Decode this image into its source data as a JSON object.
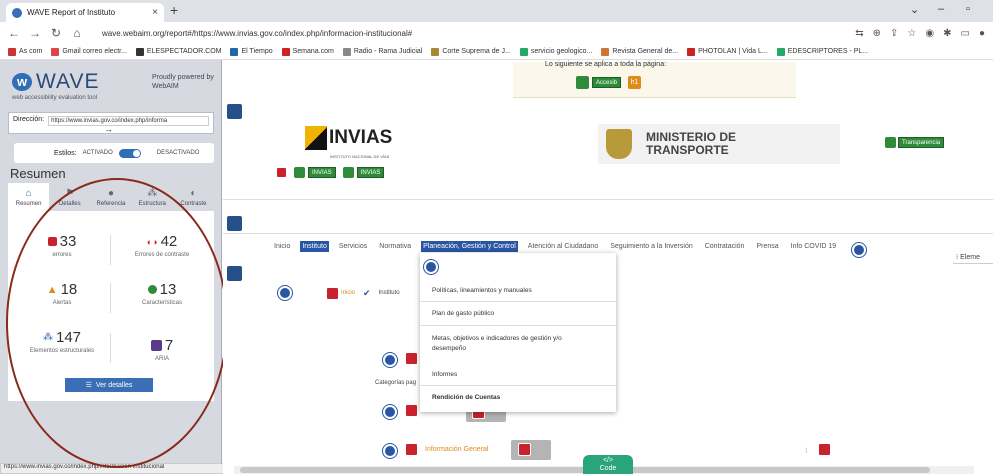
{
  "browser": {
    "tab_title": "WAVE Report of Instituto",
    "url": "wave.webaim.org/report#/https://www.invias.gov.co/index.php/informacion-institucional#",
    "bookmarks": [
      "As com",
      "Gmail correo electr...",
      "ELESPECTADOR.COM",
      "El Tiempo",
      "Semana.com",
      "Radio - Rama Judicial",
      "Corte Suprema de J...",
      "servicio geologico...",
      "Revista General de...",
      "PHOTOLAN | Vida L...",
      "EDESCRIPTORES - PL..."
    ],
    "status_url": "https://www.invias.gov.co/index.php/informacion-institucional"
  },
  "wave": {
    "logo_text": "WAVE",
    "tagline": "web accessibility evaluation tool",
    "powered_by": "Proudly powered by WebAIM",
    "address_label": "Dirección:",
    "address_value": "https://www.invias.gov.co/index.php/informa",
    "styles_label": "Estilos:",
    "styles_state": "ACTIVADO",
    "styles_off": "DESACTIVADO",
    "summary_heading": "Resumen",
    "tabs": [
      {
        "label": "Resumen",
        "icon": "home-icon"
      },
      {
        "label": "Detalles",
        "icon": "flag-icon"
      },
      {
        "label": "Referencia",
        "icon": "info-icon"
      },
      {
        "label": "Estructura",
        "icon": "structure-icon"
      },
      {
        "label": "Contraste",
        "icon": "contrast-icon"
      }
    ],
    "stats": {
      "errors": {
        "count": "33",
        "label": "errores"
      },
      "contrast": {
        "count": "42",
        "label": "Errores de contraste"
      },
      "alerts": {
        "count": "18",
        "label": "Alertas"
      },
      "features": {
        "count": "13",
        "label": "Características"
      },
      "structural": {
        "count": "147",
        "label": "Elementos estructurales"
      },
      "aria": {
        "count": "7",
        "label": "ARIA"
      }
    },
    "view_details": "Ver detalles",
    "colors": {
      "brand": "#2f6fb3",
      "error": "#c8232c",
      "alert": "#e08a1a",
      "feature": "#2f8a3a",
      "aria": "#5a3a8a"
    }
  },
  "page": {
    "wave_message": "Lo siguiente se aplica a toda la página:",
    "banner_buttons": [
      "Accesib",
      "h1"
    ],
    "invias_logo": "INVIAS",
    "invias_sub": "INSTITUTO NACIONAL DE VÍAS",
    "ministry": "MINISTERIO DE TRANSPORTE",
    "header_button": "Transparencia",
    "nav_buttons": [
      "INVIAS",
      "INVIAS"
    ],
    "menu": [
      "Inicio",
      "Instituto",
      "Servicios",
      "Normativa",
      "Planeación, Gestión y Control",
      "Atención al Ciudadano",
      "Seguimiento a la Inversión",
      "Contratación",
      "Prensa",
      "Info COVID 19"
    ],
    "menu_selected": "Planeación, Gestión y Control",
    "breadcrumb": [
      "Inicio",
      "Instituto"
    ],
    "dropdown": [
      "Políticas, lineamientos y manuales",
      "Plan de gasto público",
      "Metas, objetivos e indicadores de gestión y/o desempeño",
      "Informes",
      "Rendición de Cuentas"
    ],
    "left_label": "Categorías pag",
    "links": [
      "Información General"
    ],
    "right_cut": "Eleme",
    "code_tab": "Code"
  }
}
